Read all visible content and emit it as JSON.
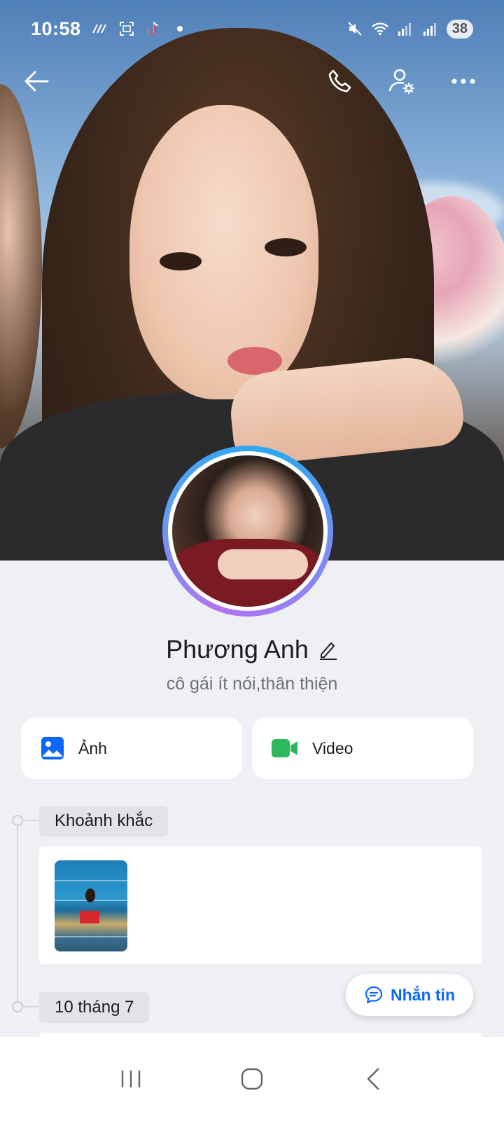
{
  "status_bar": {
    "time": "10:58",
    "battery": "38"
  },
  "profile": {
    "name": "Phương Anh",
    "bio": "cô gái ít nói,thân thiện"
  },
  "media_buttons": {
    "photos_label": "Ảnh",
    "videos_label": "Video"
  },
  "timeline": {
    "moments_label": "Khoảnh khắc",
    "date_label": "10 tháng 7"
  },
  "message_button": {
    "label": "Nhắn tin"
  },
  "colors": {
    "accent": "#0a68ff",
    "video_green": "#2db85b",
    "background": "#eff0f4"
  },
  "icons": [
    "back-arrow-icon",
    "phone-icon",
    "user-settings-icon",
    "more-icon",
    "edit-pencil-icon",
    "image-icon",
    "video-camera-icon",
    "chat-bubble-icon",
    "recents-icon",
    "home-icon",
    "back-nav-icon"
  ]
}
